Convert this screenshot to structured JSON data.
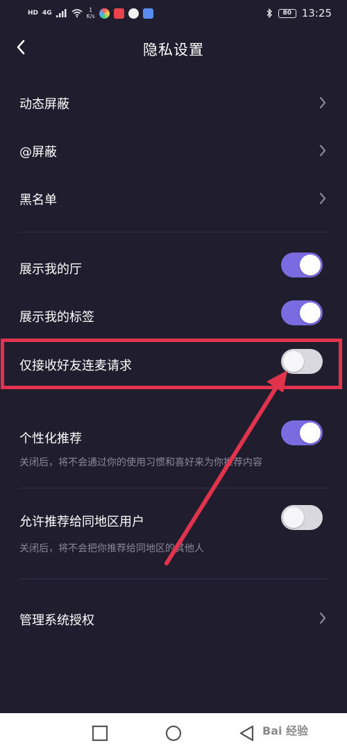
{
  "status_bar": {
    "hd": "HD",
    "network": "4G",
    "speed_value": "1",
    "speed_unit": "K/s",
    "battery": "80",
    "time": "13:25"
  },
  "header": {
    "title": "隐私设置"
  },
  "nav_rows": [
    {
      "label": "动态屏蔽"
    },
    {
      "label": "@屏蔽"
    },
    {
      "label": "黑名单"
    }
  ],
  "toggle_rows": [
    {
      "label": "展示我的厅",
      "on": true
    },
    {
      "label": "展示我的标签",
      "on": true
    },
    {
      "label": "仅接收好友连麦请求",
      "on": false
    },
    {
      "label": "个性化推荐",
      "on": true,
      "desc": "关闭后，将不会通过你的使用习惯和喜好来为你推荐内容"
    },
    {
      "label": "允许推荐给同地区用户",
      "on": false,
      "desc": "关闭后，将不会把你推荐给同地区的其他人"
    }
  ],
  "manage_row": {
    "label": "管理系统授权"
  },
  "watermark": "Bai 经验",
  "colors": {
    "background": "#1f1d2e",
    "toggle_on": "#7a6ce0",
    "toggle_off": "#d8d8de",
    "annotation": "#e2334d"
  }
}
